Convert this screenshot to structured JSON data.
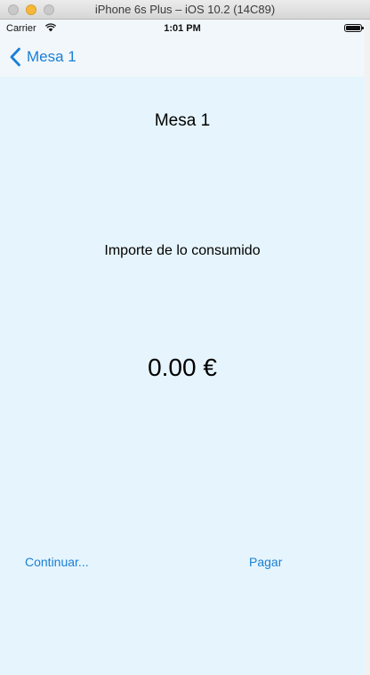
{
  "window": {
    "title": "iPhone 6s Plus – iOS 10.2 (14C89)"
  },
  "status_bar": {
    "carrier": "Carrier",
    "time": "1:01 PM",
    "wifi_icon": "wifi-icon",
    "battery_icon": "battery-icon"
  },
  "nav": {
    "back_label": "Mesa 1",
    "back_icon": "chevron-left-icon"
  },
  "main": {
    "title": "Mesa 1",
    "subtitle": "Importe de lo consumido",
    "amount": "0.00 €"
  },
  "actions": {
    "continue_label": "Continuar...",
    "pay_label": "Pagar"
  },
  "colors": {
    "accent": "#1a7fd6",
    "background": "#e6f5fd",
    "bar_background": "#f1f7fa"
  }
}
